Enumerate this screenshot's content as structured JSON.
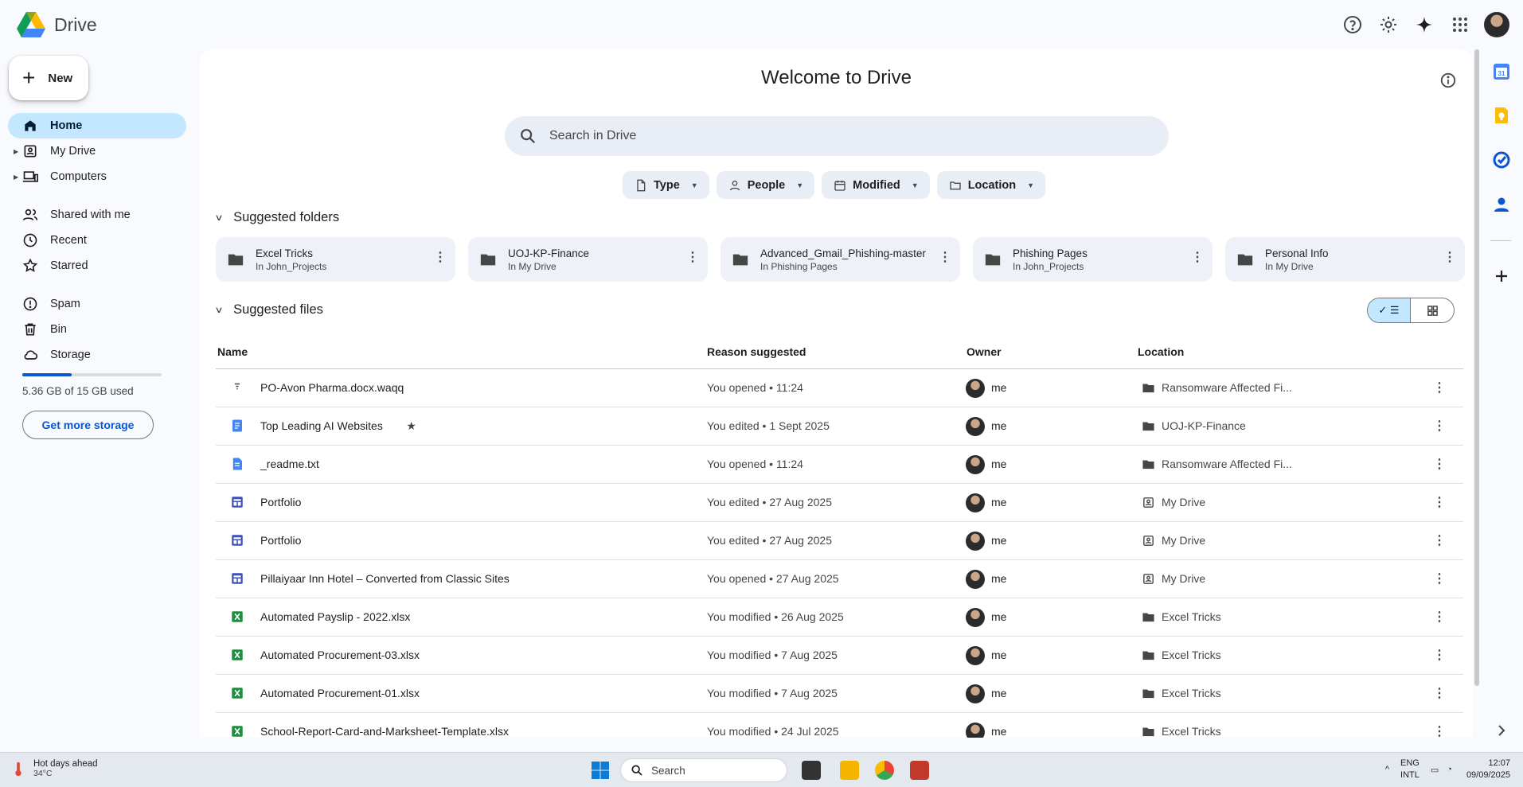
{
  "app": {
    "name": "Drive"
  },
  "sidebar": {
    "new_label": "New",
    "items": [
      {
        "label": "Home",
        "icon": "home-icon"
      },
      {
        "label": "My Drive",
        "icon": "my-drive-icon"
      },
      {
        "label": "Computers",
        "icon": "computers-icon"
      },
      {
        "label": "Shared with me",
        "icon": "shared-icon"
      },
      {
        "label": "Recent",
        "icon": "clock-icon"
      },
      {
        "label": "Starred",
        "icon": "star-icon"
      },
      {
        "label": "Spam",
        "icon": "spam-icon"
      },
      {
        "label": "Bin",
        "icon": "bin-icon"
      },
      {
        "label": "Storage",
        "icon": "cloud-icon"
      }
    ],
    "storage_used_fraction": 0.357,
    "storage_text": "5.36 GB of 15 GB used",
    "storage_button": "Get more storage"
  },
  "main": {
    "title": "Welcome to Drive",
    "search_placeholder": "Search in Drive",
    "filters": [
      "Type",
      "People",
      "Modified",
      "Location"
    ],
    "suggested_folders_title": "Suggested folders",
    "folders": [
      {
        "name": "Excel Tricks",
        "location": "In John_Projects"
      },
      {
        "name": "UOJ-KP-Finance",
        "location": "In My Drive"
      },
      {
        "name": "Advanced_Gmail_Phishing-master",
        "location": "In Phishing Pages"
      },
      {
        "name": "Phishing Pages",
        "location": "In John_Projects"
      },
      {
        "name": "Personal Info",
        "location": "In My Drive"
      }
    ],
    "suggested_files_title": "Suggested files",
    "columns": {
      "name": "Name",
      "reason": "Reason suggested",
      "owner": "Owner",
      "location": "Location"
    },
    "files": [
      {
        "name": "PO-Avon Pharma.docx.waqq",
        "type": "generic",
        "reason": "You opened • 11:24",
        "owner": "me",
        "location": "Ransomware Affected Fi...",
        "loc_type": "folder"
      },
      {
        "name": "Top Leading AI Websites",
        "type": "doc",
        "starred": true,
        "reason": "You edited • 1 Sept 2025",
        "owner": "me",
        "location": "UOJ-KP-Finance",
        "loc_type": "folder"
      },
      {
        "name": "_readme.txt",
        "type": "txt",
        "reason": "You opened • 11:24",
        "owner": "me",
        "location": "Ransomware Affected Fi...",
        "loc_type": "folder"
      },
      {
        "name": "Portfolio",
        "type": "site",
        "reason": "You edited • 27 Aug 2025",
        "owner": "me",
        "location": "My Drive",
        "loc_type": "drive"
      },
      {
        "name": "Portfolio",
        "type": "site",
        "reason": "You edited • 27 Aug 2025",
        "owner": "me",
        "location": "My Drive",
        "loc_type": "drive"
      },
      {
        "name": "Pillaiyaar Inn Hotel  – Converted from Classic Sites",
        "type": "site",
        "reason": "You opened • 27 Aug 2025",
        "owner": "me",
        "location": "My Drive",
        "loc_type": "drive"
      },
      {
        "name": "Automated Payslip - 2022.xlsx",
        "type": "xlsx",
        "reason": "You modified • 26 Aug 2025",
        "owner": "me",
        "location": "Excel Tricks",
        "loc_type": "folder"
      },
      {
        "name": "Automated Procurement-03.xlsx",
        "type": "xlsx",
        "reason": "You modified • 7 Aug 2025",
        "owner": "me",
        "location": "Excel Tricks",
        "loc_type": "folder"
      },
      {
        "name": "Automated Procurement-01.xlsx",
        "type": "xlsx",
        "reason": "You modified • 7 Aug 2025",
        "owner": "me",
        "location": "Excel Tricks",
        "loc_type": "folder"
      },
      {
        "name": "School-Report-Card-and-Marksheet-Template.xlsx",
        "type": "xlsx",
        "reason": "You modified • 24 Jul 2025",
        "owner": "me",
        "location": "Excel Tricks",
        "loc_type": "folder"
      }
    ]
  },
  "taskbar": {
    "weather_title": "Hot days ahead",
    "weather_temp": "34°C",
    "search_label": "Search",
    "lang_1": "ENG",
    "lang_2": "INTL",
    "time": "12:07",
    "date": "09/09/2025"
  },
  "colors": {
    "accent": "#0b57d0",
    "active_nav": "#c2e7ff",
    "sheets": "#1e8e3e",
    "docs": "#4285f4",
    "sites": "#3f51b5"
  }
}
